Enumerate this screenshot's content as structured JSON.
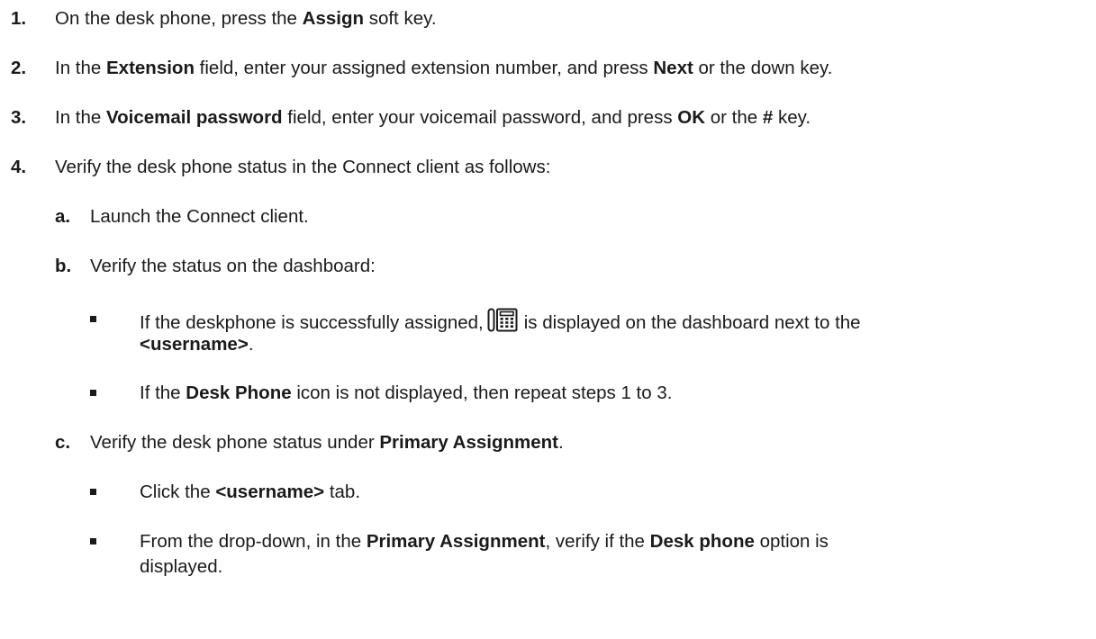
{
  "steps": [
    {
      "num": "1.",
      "t1": "On the desk phone, press the ",
      "b1": "Assign",
      "t2": " soft key."
    },
    {
      "num": "2.",
      "t1": "In the ",
      "b1": "Extension",
      "t2": " field, enter your assigned extension number, and press ",
      "b2": "Next",
      "t3": " or the down key."
    },
    {
      "num": "3.",
      "t1": "In the ",
      "b1": "Voicemail password",
      "t2": " field, enter your voicemail password, and press ",
      "b2": "OK",
      "t3": " or the ",
      "b3": "#",
      "t4": " key."
    },
    {
      "num": "4.",
      "t1": "Verify the desk phone status in the Connect client as follows:"
    }
  ],
  "substeps": {
    "a": {
      "num": "a.",
      "t1": "Launch the Connect client."
    },
    "b": {
      "num": "b.",
      "t1": "Verify the status on the dashboard:",
      "bullet1": {
        "t1": "If the deskphone is successfully assigned,",
        "t2": "is displayed on the dashboard next to the",
        "b1": "<username>",
        "t3": "."
      },
      "bullet2": {
        "t1": "If the ",
        "b1": "Desk Phone",
        "t2": " icon is not displayed, then repeat steps 1 to 3."
      }
    },
    "c": {
      "num": "c.",
      "t1": "Verify the desk phone status under ",
      "b1": "Primary Assignment",
      "t2": ".",
      "bullet1": {
        "t1": "Click the ",
        "b1": "<username>",
        "t2": " tab."
      },
      "bullet2": {
        "t1": "From the drop-down, in the ",
        "b1": "Primary Assignment",
        "t2": ", verify if the ",
        "b2": "Desk phone",
        "t3": " option is",
        "t4": "displayed."
      }
    }
  },
  "icons": {
    "desk_phone": "desk-phone-icon"
  }
}
